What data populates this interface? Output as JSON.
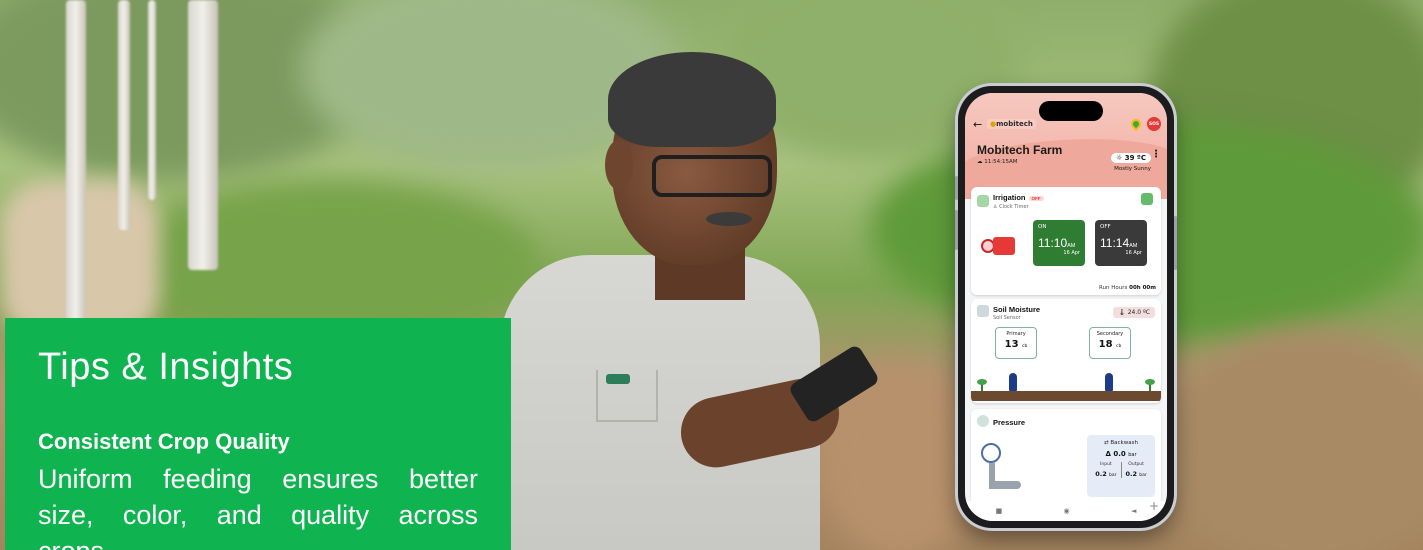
{
  "tips": {
    "title": "Tips & Insights",
    "subtitle": "Consistent Crop Quality",
    "body": "Uniform feeding ensures better size, color, and quality across crops."
  },
  "app": {
    "logo": "mobitech",
    "farm_name": "Mobitech Farm",
    "time": "11:54:15AM",
    "temperature": "39 ºC",
    "weather": "Mostly Sunny",
    "sos_label": "SOS",
    "irrigation": {
      "title": "Irrigation",
      "status": "OFF",
      "mode": "Clock Timer",
      "on_label": "ON",
      "on_time": "11:10",
      "on_ampm": "AM",
      "on_date": "16 Apr",
      "off_label": "OFF",
      "off_time": "11:14",
      "off_ampm": "AM",
      "off_date": "16 Apr",
      "run_hours_label": "Run Hours",
      "run_hours_value": "00h 00m",
      "on_color": "#2e7d32",
      "off_color": "#3a3a3a"
    },
    "soil": {
      "title": "Soil Moisture",
      "subtitle": "Soil Sensor",
      "temp": "24.0 ºC",
      "primary_label": "Primary",
      "primary_value": "13",
      "secondary_label": "Secondary",
      "secondary_value": "18",
      "unit": "cb"
    },
    "pressure": {
      "title": "Pressure",
      "backwash_label": "Backwash",
      "backwash_value": "0.0",
      "unit": "bar",
      "input_label": "Input",
      "input_value": "0.2",
      "output_label": "Output",
      "output_value": "0.2"
    },
    "nav": [
      "■",
      "◉",
      "◄"
    ]
  },
  "colors": {
    "tips_bg": "#0fb34f",
    "accent_green": "#2e7d32"
  }
}
